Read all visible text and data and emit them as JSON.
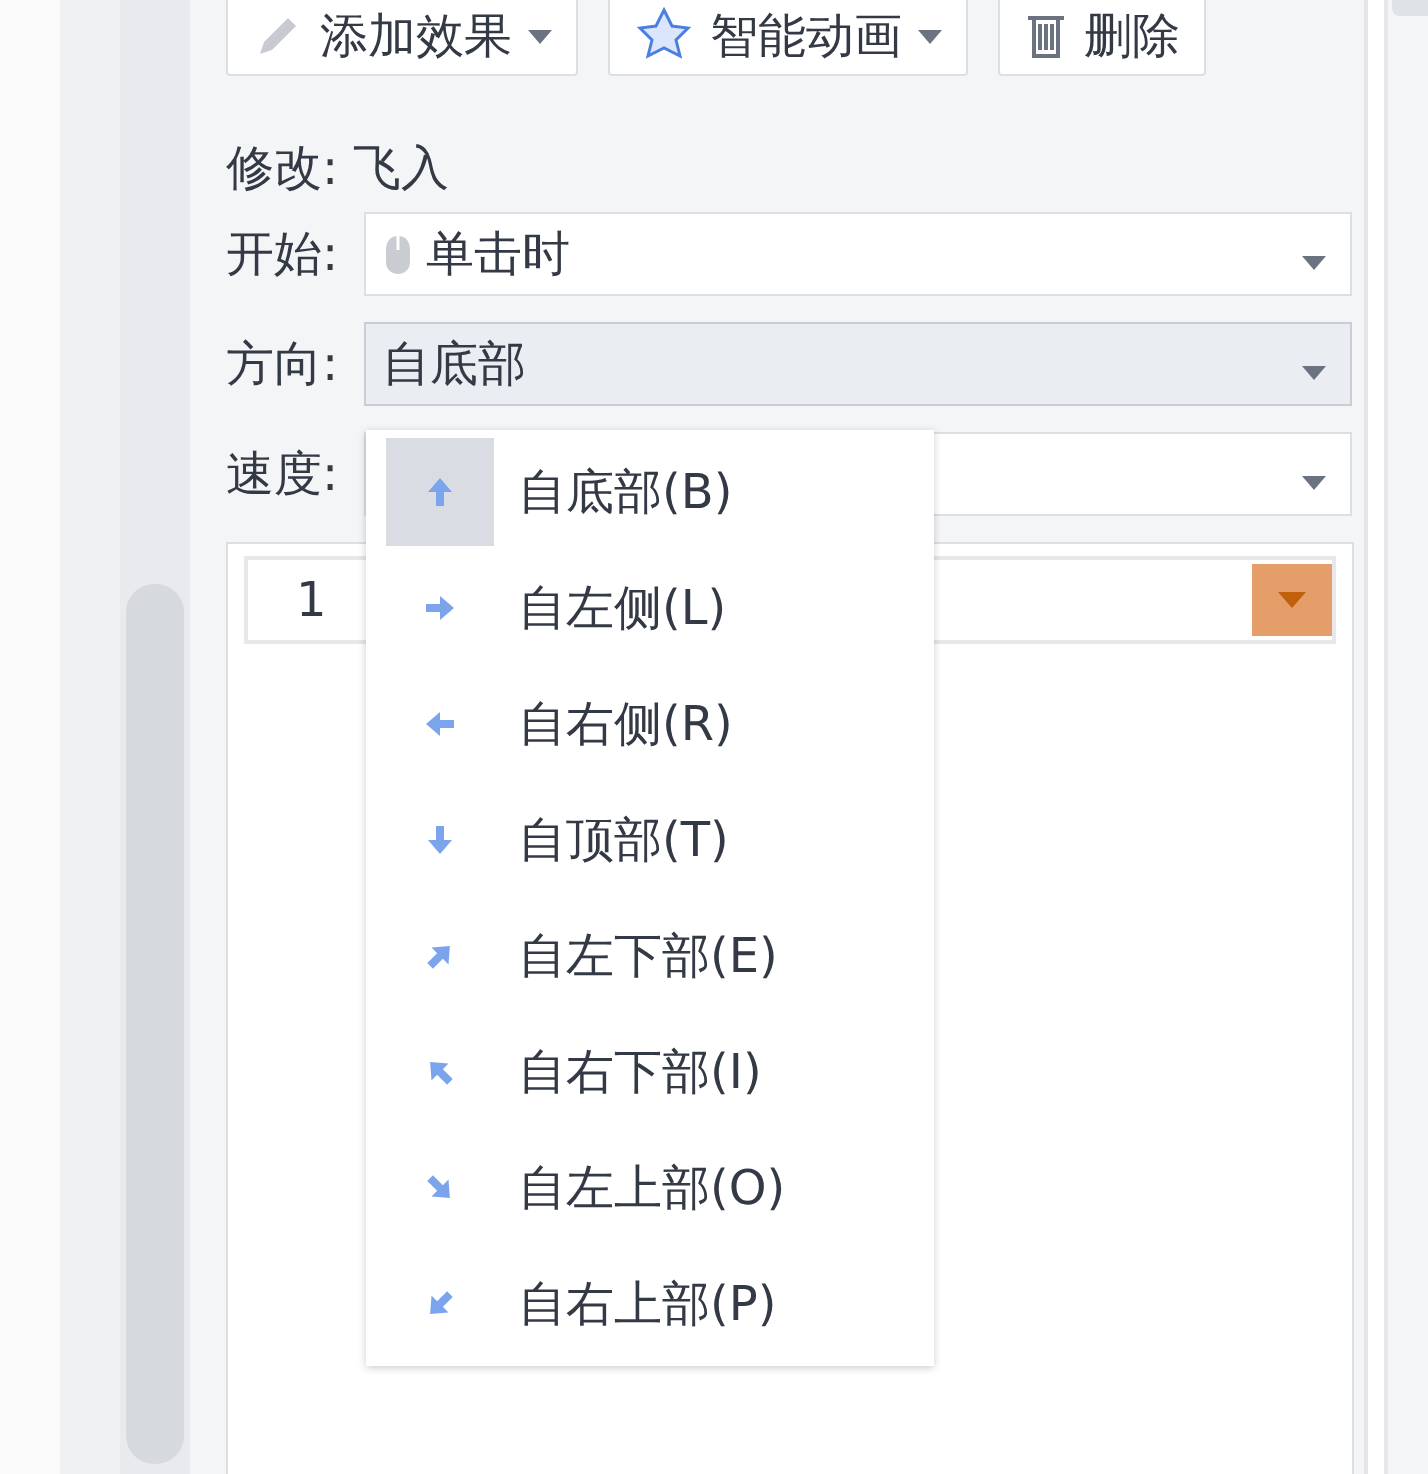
{
  "toolbar": {
    "buttons": [
      {
        "label": "添加效果",
        "dropdown": true
      },
      {
        "label": "智能动画",
        "dropdown": true
      },
      {
        "label": "删除",
        "dropdown": false
      }
    ]
  },
  "modify_label": "修改: 飞入",
  "fields": [
    {
      "label": "开始:",
      "value": "单击时",
      "active": false
    },
    {
      "label": "方向:",
      "value": "自底部",
      "active": true
    },
    {
      "label": "速度:",
      "active": false
    }
  ],
  "animation_list": {
    "rows": [
      {
        "number": "1"
      }
    ]
  },
  "direction_menu": {
    "items": [
      {
        "label": "自底部(B)",
        "selected": true
      },
      {
        "label": "自左侧(L)",
        "selected": false
      },
      {
        "label": "自右侧(R)",
        "selected": false
      },
      {
        "label": "自顶部(T)",
        "selected": false
      },
      {
        "label": "自左下部(E)",
        "selected": false
      },
      {
        "label": "自右下部(I)",
        "selected": false
      },
      {
        "label": "自左上部(O)",
        "selected": false
      },
      {
        "label": "自右上部(P)",
        "selected": false
      }
    ]
  }
}
